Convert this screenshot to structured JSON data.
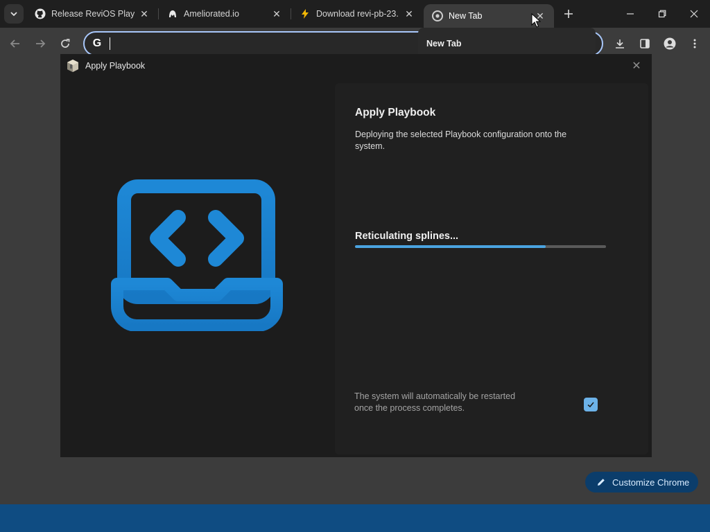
{
  "browser": {
    "tabs": [
      {
        "title": "Release ReviOS Playbook",
        "icon": "github-icon",
        "active": false
      },
      {
        "title": "Ameliorated.io",
        "icon": "ameliorated-icon",
        "active": false
      },
      {
        "title": "Download revi-pb-23.",
        "icon": "lightning-icon",
        "active": false
      },
      {
        "title": "New Tab",
        "icon": "chrome-icon",
        "active": true
      }
    ],
    "hover_card_title": "New Tab",
    "omnibox_value": ""
  },
  "dialog": {
    "title": "Apply Playbook",
    "heading": "Apply Playbook",
    "description": "Deploying the selected Playbook configuration onto the system.",
    "progress_label": "Reticulating splines...",
    "progress_percent": 76,
    "restart_text": "The system will automatically be restarted once the process completes.",
    "restart_checked": true
  },
  "page": {
    "customize_label": "Customize Chrome"
  },
  "colors": {
    "accent": "#4aa3e0",
    "art_blue": "#1e88d6",
    "taskbar": "#0f4c82"
  }
}
